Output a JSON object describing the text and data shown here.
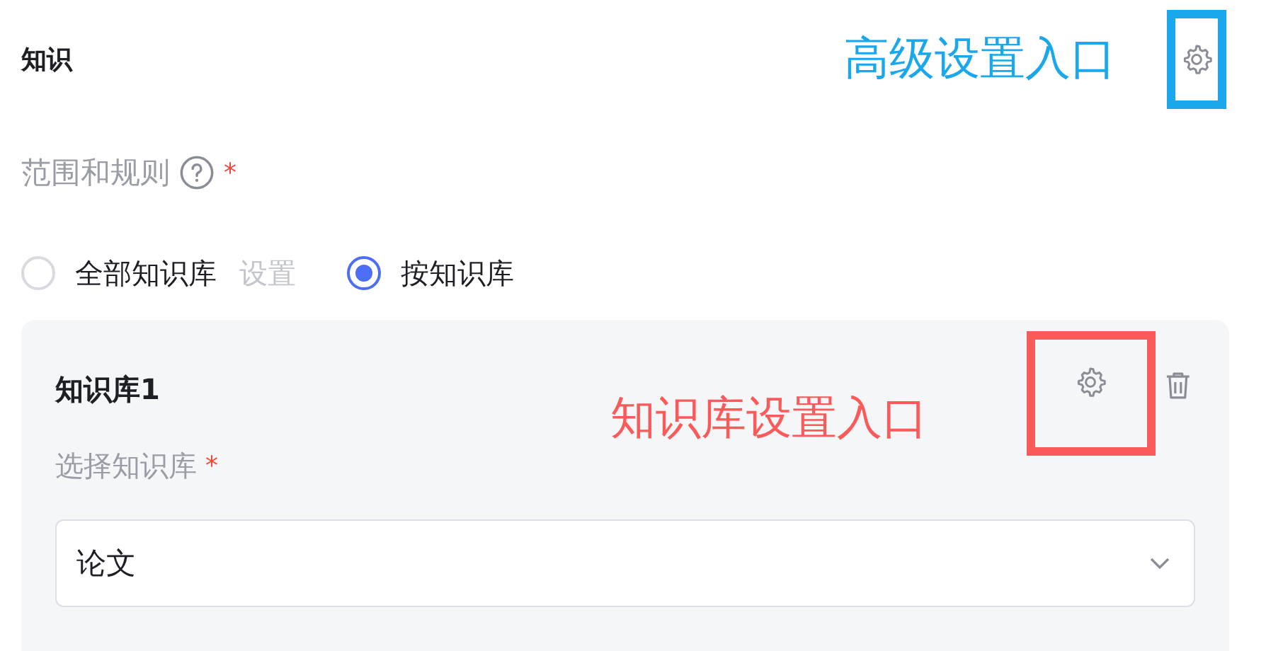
{
  "section_title": "知识",
  "advanced_annotation": {
    "text": "高级设置入口",
    "color": "#1aa7ec"
  },
  "scope_label": {
    "text": "范围和规则",
    "required_mark": "*"
  },
  "scope_options": [
    {
      "label": "全部知识库",
      "selected": false,
      "link": "设置"
    },
    {
      "label": "按知识库",
      "selected": true
    }
  ],
  "knowledge_bases": [
    {
      "title": "知识库1",
      "annotation": {
        "text": "知识库设置入口",
        "color": "#fa5a5a"
      },
      "field_label": "选择知识库",
      "required_mark": "*",
      "value": "论文"
    }
  ]
}
